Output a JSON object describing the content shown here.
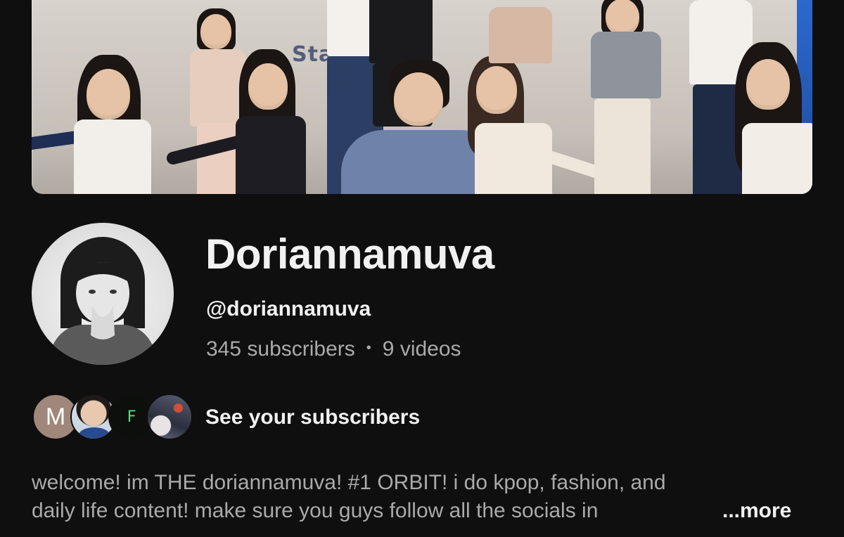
{
  "channel": {
    "name": "Doriannamuva",
    "handle": "@doriannamuva",
    "subscribers": "345 subscribers",
    "separator": "•",
    "videos": "9 videos"
  },
  "banner": {
    "watermark_text": "Starry Cre",
    "accent_color": "#2d6bd1"
  },
  "subscribers_row": {
    "avatars": [
      {
        "type": "letter",
        "letter": "M",
        "color": "#a0877b"
      },
      {
        "type": "photo",
        "icon": "person-photo-icon"
      },
      {
        "type": "logo",
        "letter": "F",
        "color": "#5ddc7a"
      },
      {
        "type": "photo",
        "icon": "artwork-photo-icon"
      }
    ],
    "label": "See your subscribers"
  },
  "description": {
    "line1": "welcome! im THE doriannamuva! #1 ORBIT! i do kpop, fashion, and",
    "line2": "daily life content! make sure you guys follow all the socials in",
    "more_label": "...more"
  },
  "colors": {
    "background": "#0f0f0f",
    "primary_text": "#f1f1f1",
    "secondary_text": "#aaaaaa"
  }
}
